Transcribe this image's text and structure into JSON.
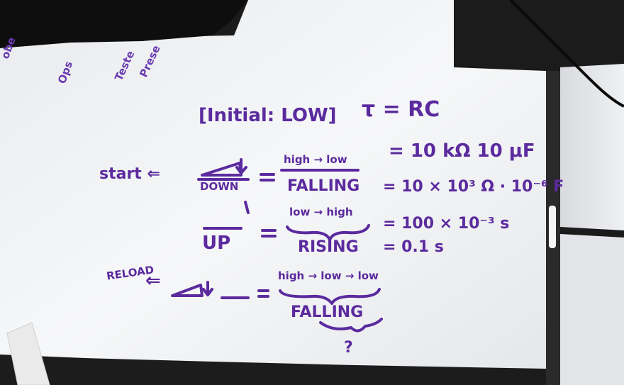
{
  "whiteboard": {
    "header": "[Initial: LOW]",
    "tau_line1": "τ = RC",
    "tau_line2": "= 10 kΩ 10 μF",
    "tau_line3": "= 10 × 10³ Ω · 10⁻⁶ F",
    "tau_line4": "= 100 × 10⁻³ s",
    "tau_line5": "= 0.1 s",
    "row1": {
      "left_label": "start ⇐",
      "symbol_label": "DOWN",
      "equals": "=",
      "top_text": "high → low",
      "bottom_text": "FALLING"
    },
    "row2": {
      "symbol_label": "UP",
      "equals": "=",
      "top_text": "low → high",
      "bottom_text": "RISING"
    },
    "row3": {
      "left_label": "RELOAD",
      "left_arrow": "⇐",
      "equals": "=",
      "top_text": "high → low → low",
      "bottom_text": "FALLING",
      "question": "?"
    },
    "top_left_scribbles": [
      "obe",
      "Ops",
      "Teste",
      "Prese"
    ]
  },
  "colors": {
    "ink": "#5b2a9e",
    "board": "#f2f3f5",
    "frame": "#1a1a1a"
  }
}
